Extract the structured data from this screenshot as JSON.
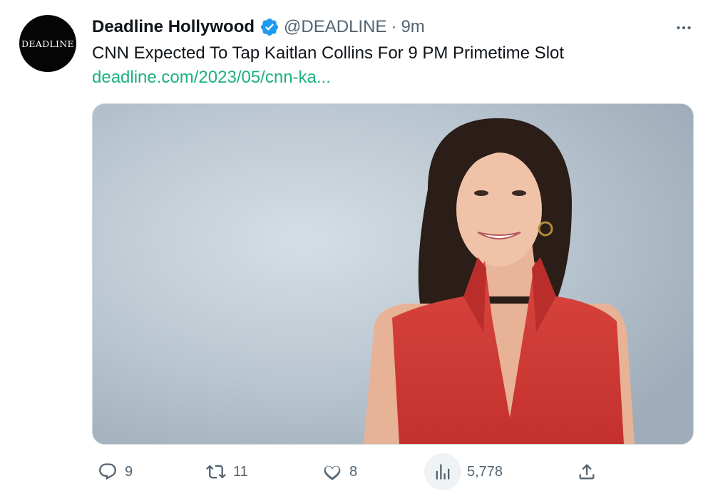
{
  "tweet": {
    "avatar_text": "DEADLINE",
    "display_name": "Deadline Hollywood",
    "handle": "@DEADLINE",
    "separator": "·",
    "timestamp": "9m",
    "text": "CNN Expected To Tap Kaitlan Collins For 9 PM Primetime Slot",
    "link": "deadline.com/2023/05/cnn-ka..."
  },
  "actions": {
    "replies": "9",
    "retweets": "11",
    "likes": "8",
    "views": "5,778"
  },
  "icons": {
    "verified": "verified-badge-icon",
    "more": "more-options-icon",
    "reply": "reply-icon",
    "retweet": "retweet-icon",
    "like": "heart-icon",
    "views": "views-icon",
    "share": "share-icon"
  },
  "colors": {
    "link": "#1db17a",
    "verified": "#1d9bf0",
    "muted": "#536471"
  }
}
